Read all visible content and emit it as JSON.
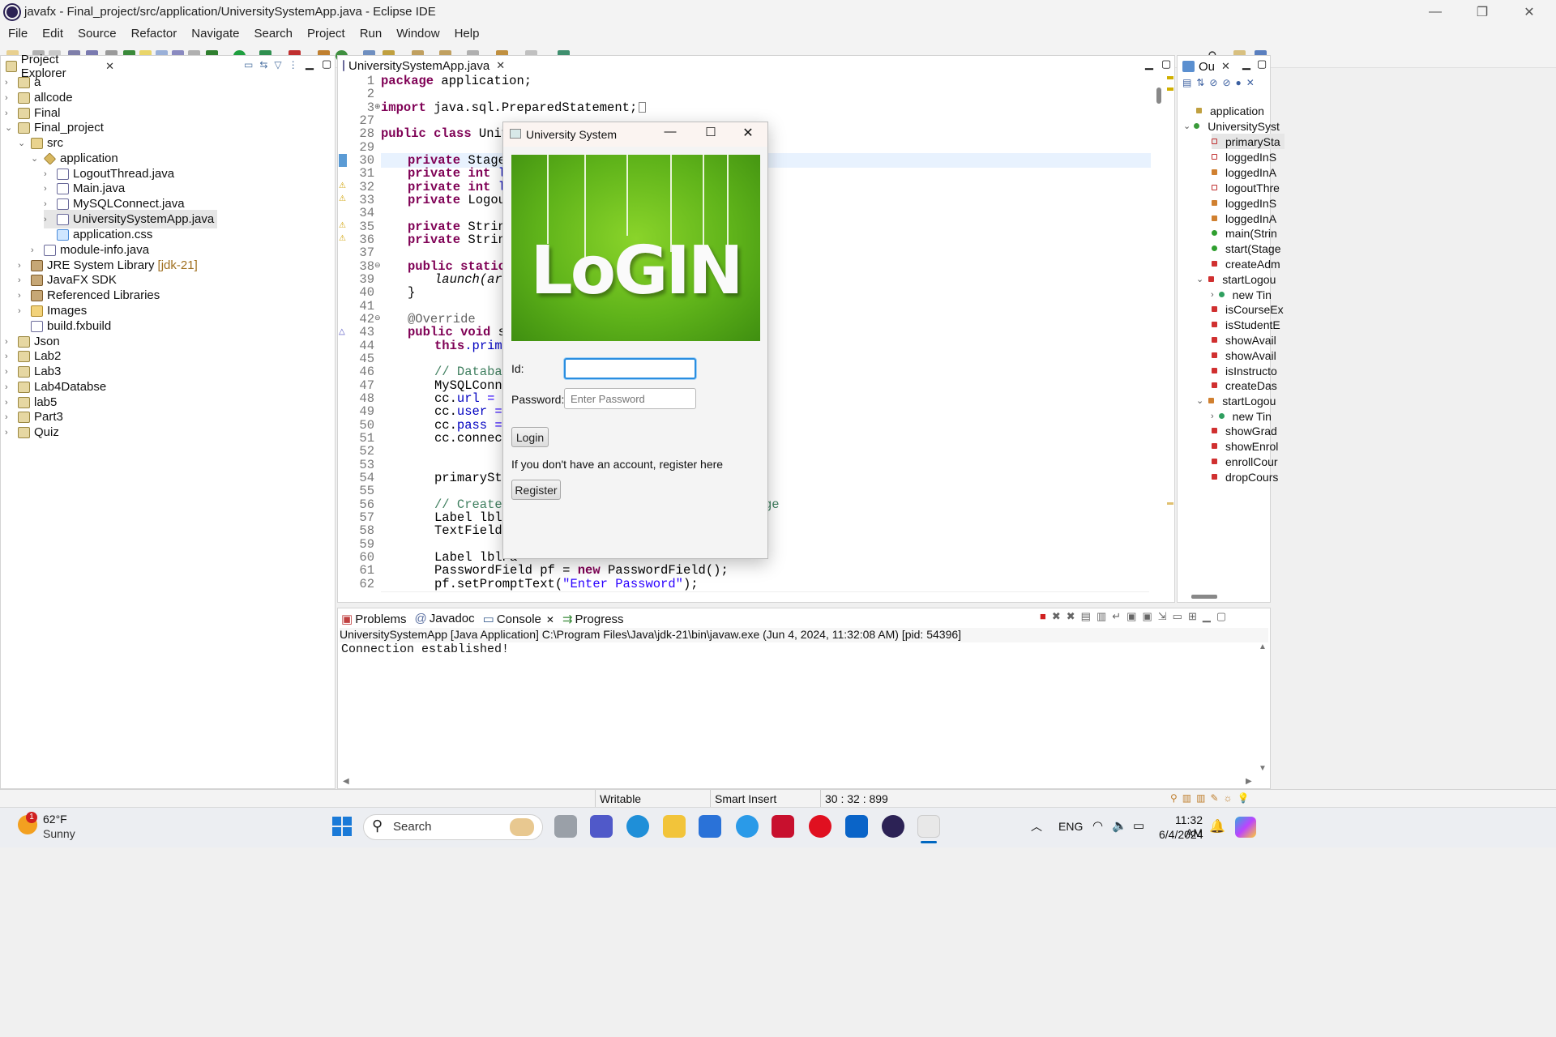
{
  "window": {
    "title": "javafx - Final_project/src/application/UniversitySystemApp.java - Eclipse IDE"
  },
  "menu": [
    "File",
    "Edit",
    "Source",
    "Refactor",
    "Navigate",
    "Search",
    "Project",
    "Run",
    "Window",
    "Help"
  ],
  "project_explorer": {
    "tab": "Project Explorer",
    "items": [
      "a",
      "allcode",
      "Final",
      "Final_project",
      "src",
      "application",
      "LogoutThread.java",
      "Main.java",
      "MySQLConnect.java",
      "UniversitySystemApp.java",
      "application.css",
      "module-info.java",
      "JRE System Library",
      "[jdk-21]",
      "JavaFX SDK",
      "Referenced Libraries",
      "Images",
      "build.fxbuild",
      "Json",
      "Lab2",
      "Lab3",
      "Lab4Databse",
      "lab5",
      "Part3",
      "Quiz"
    ]
  },
  "editor": {
    "tab": "UniversitySystemApp.java",
    "line_numbers": [
      "1",
      "2",
      "3",
      "27",
      "28",
      "29",
      "30",
      "31",
      "32",
      "33",
      "34",
      "35",
      "36",
      "37",
      "38",
      "39",
      "40",
      "41",
      "42",
      "43",
      "44",
      "45",
      "46",
      "47",
      "48",
      "49",
      "50",
      "51",
      "52",
      "53",
      "54",
      "55",
      "56",
      "57",
      "58",
      "59",
      "60",
      "61",
      "62"
    ],
    "code": {
      "l1a": "package",
      "l1b": " application;",
      "l3a": "import",
      "l3b": " java.sql.PreparedStatement;",
      "l28a": "public class",
      "l28b": " Univer",
      "l30a": "private",
      "l30b": " Stage ",
      "l31a": "private int",
      "l31b": "lo",
      "l32a": "private int",
      "l32b": "lo",
      "l33a": "private",
      "l33b": " Logout",
      "l35a": "private",
      "l35b": " String",
      "l36a": "private",
      "l36b": " String",
      "l38a": "public static",
      "l38b": "v",
      "l39": "launch(args",
      "l40": "}",
      "l42": "@Override",
      "l43a": "public void",
      "l43b": " sta",
      "l44a": "this",
      "l44b": ".primar",
      "l46": "// Database",
      "l47": "MySQLConne",
      "l48a": "cc.",
      "l48b": "url",
      "l48c": " = \"",
      "l49a": "cc.",
      "l49b": "user",
      "l49c": " = \"",
      "l50a": "cc.",
      "l50b": "pass",
      "l50c": " = \"",
      "l51": "cc.connect",
      "l54": "primarySta",
      "l56": "// Create U",
      "l56end": "ge",
      "l57": "Label lblSt",
      "l58": "TextField t",
      "l60a": "Label lblPa",
      "l61a": "PasswordField pf = ",
      "l61b": "new",
      "l61c": " PasswordField();",
      "l62a": "pf.setPromptText(",
      "l62b": "\"Enter Password\"",
      "l62c": ");"
    }
  },
  "outline": {
    "tab": "Ou",
    "items": [
      "application",
      "UniversitySyst",
      "primarySta",
      "loggedInS",
      "loggedInA",
      "logoutThre",
      "loggedInS",
      "loggedInA",
      "main(Strin",
      "start(Stage",
      "createAdm",
      "startLogou",
      "new Tin",
      "isCourseEx",
      "isStudentE",
      "showAvail",
      "showAvail",
      "isInstructo",
      "createDas",
      "startLogou",
      "new Tin",
      "showGrad",
      "showEnrol",
      "enrollCour",
      "dropCours"
    ]
  },
  "console": {
    "tabs": [
      "Problems",
      "Javadoc",
      "Console",
      "Progress"
    ],
    "header": "UniversitySystemApp [Java Application] C:\\Program Files\\Java\\jdk-21\\bin\\javaw.exe  (Jun 4, 2024, 11:32:08 AM) [pid: 54396]",
    "output": "Connection established!"
  },
  "status_bar": {
    "writable": "Writable",
    "insert": "Smart Insert",
    "position": "30 : 32 : 899"
  },
  "dialog": {
    "title": "University System",
    "banner_text": "LoGIN",
    "id_label": "Id:",
    "password_label": "Password:",
    "password_placeholder": "Enter Password",
    "login_button": "Login",
    "register_prompt": "If you don't have an account, register here",
    "register_button": "Register"
  },
  "taskbar": {
    "weather_temp": "62°F",
    "weather_desc": "Sunny",
    "weather_badge": "1",
    "search_placeholder": "Search",
    "language": "ENG",
    "time": "11:32 AM",
    "date": "6/4/2024"
  },
  "colors": {
    "accent": "#0067c0",
    "keyword": "#7f0055",
    "comment": "#3f7f5f",
    "string": "#2a00ff",
    "login_green": "#5fb31a"
  }
}
